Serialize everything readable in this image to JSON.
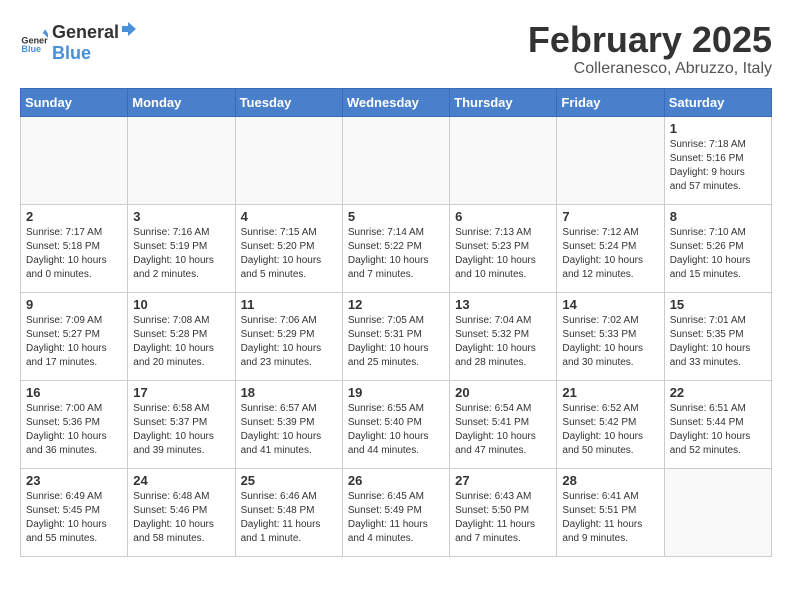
{
  "header": {
    "logo_general": "General",
    "logo_blue": "Blue",
    "title": "February 2025",
    "subtitle": "Colleranesco, Abruzzo, Italy"
  },
  "weekdays": [
    "Sunday",
    "Monday",
    "Tuesday",
    "Wednesday",
    "Thursday",
    "Friday",
    "Saturday"
  ],
  "weeks": [
    [
      {
        "day": "",
        "info": ""
      },
      {
        "day": "",
        "info": ""
      },
      {
        "day": "",
        "info": ""
      },
      {
        "day": "",
        "info": ""
      },
      {
        "day": "",
        "info": ""
      },
      {
        "day": "",
        "info": ""
      },
      {
        "day": "1",
        "info": "Sunrise: 7:18 AM\nSunset: 5:16 PM\nDaylight: 9 hours\nand 57 minutes."
      }
    ],
    [
      {
        "day": "2",
        "info": "Sunrise: 7:17 AM\nSunset: 5:18 PM\nDaylight: 10 hours\nand 0 minutes."
      },
      {
        "day": "3",
        "info": "Sunrise: 7:16 AM\nSunset: 5:19 PM\nDaylight: 10 hours\nand 2 minutes."
      },
      {
        "day": "4",
        "info": "Sunrise: 7:15 AM\nSunset: 5:20 PM\nDaylight: 10 hours\nand 5 minutes."
      },
      {
        "day": "5",
        "info": "Sunrise: 7:14 AM\nSunset: 5:22 PM\nDaylight: 10 hours\nand 7 minutes."
      },
      {
        "day": "6",
        "info": "Sunrise: 7:13 AM\nSunset: 5:23 PM\nDaylight: 10 hours\nand 10 minutes."
      },
      {
        "day": "7",
        "info": "Sunrise: 7:12 AM\nSunset: 5:24 PM\nDaylight: 10 hours\nand 12 minutes."
      },
      {
        "day": "8",
        "info": "Sunrise: 7:10 AM\nSunset: 5:26 PM\nDaylight: 10 hours\nand 15 minutes."
      }
    ],
    [
      {
        "day": "9",
        "info": "Sunrise: 7:09 AM\nSunset: 5:27 PM\nDaylight: 10 hours\nand 17 minutes."
      },
      {
        "day": "10",
        "info": "Sunrise: 7:08 AM\nSunset: 5:28 PM\nDaylight: 10 hours\nand 20 minutes."
      },
      {
        "day": "11",
        "info": "Sunrise: 7:06 AM\nSunset: 5:29 PM\nDaylight: 10 hours\nand 23 minutes."
      },
      {
        "day": "12",
        "info": "Sunrise: 7:05 AM\nSunset: 5:31 PM\nDaylight: 10 hours\nand 25 minutes."
      },
      {
        "day": "13",
        "info": "Sunrise: 7:04 AM\nSunset: 5:32 PM\nDaylight: 10 hours\nand 28 minutes."
      },
      {
        "day": "14",
        "info": "Sunrise: 7:02 AM\nSunset: 5:33 PM\nDaylight: 10 hours\nand 30 minutes."
      },
      {
        "day": "15",
        "info": "Sunrise: 7:01 AM\nSunset: 5:35 PM\nDaylight: 10 hours\nand 33 minutes."
      }
    ],
    [
      {
        "day": "16",
        "info": "Sunrise: 7:00 AM\nSunset: 5:36 PM\nDaylight: 10 hours\nand 36 minutes."
      },
      {
        "day": "17",
        "info": "Sunrise: 6:58 AM\nSunset: 5:37 PM\nDaylight: 10 hours\nand 39 minutes."
      },
      {
        "day": "18",
        "info": "Sunrise: 6:57 AM\nSunset: 5:39 PM\nDaylight: 10 hours\nand 41 minutes."
      },
      {
        "day": "19",
        "info": "Sunrise: 6:55 AM\nSunset: 5:40 PM\nDaylight: 10 hours\nand 44 minutes."
      },
      {
        "day": "20",
        "info": "Sunrise: 6:54 AM\nSunset: 5:41 PM\nDaylight: 10 hours\nand 47 minutes."
      },
      {
        "day": "21",
        "info": "Sunrise: 6:52 AM\nSunset: 5:42 PM\nDaylight: 10 hours\nand 50 minutes."
      },
      {
        "day": "22",
        "info": "Sunrise: 6:51 AM\nSunset: 5:44 PM\nDaylight: 10 hours\nand 52 minutes."
      }
    ],
    [
      {
        "day": "23",
        "info": "Sunrise: 6:49 AM\nSunset: 5:45 PM\nDaylight: 10 hours\nand 55 minutes."
      },
      {
        "day": "24",
        "info": "Sunrise: 6:48 AM\nSunset: 5:46 PM\nDaylight: 10 hours\nand 58 minutes."
      },
      {
        "day": "25",
        "info": "Sunrise: 6:46 AM\nSunset: 5:48 PM\nDaylight: 11 hours\nand 1 minute."
      },
      {
        "day": "26",
        "info": "Sunrise: 6:45 AM\nSunset: 5:49 PM\nDaylight: 11 hours\nand 4 minutes."
      },
      {
        "day": "27",
        "info": "Sunrise: 6:43 AM\nSunset: 5:50 PM\nDaylight: 11 hours\nand 7 minutes."
      },
      {
        "day": "28",
        "info": "Sunrise: 6:41 AM\nSunset: 5:51 PM\nDaylight: 11 hours\nand 9 minutes."
      },
      {
        "day": "",
        "info": ""
      }
    ]
  ]
}
